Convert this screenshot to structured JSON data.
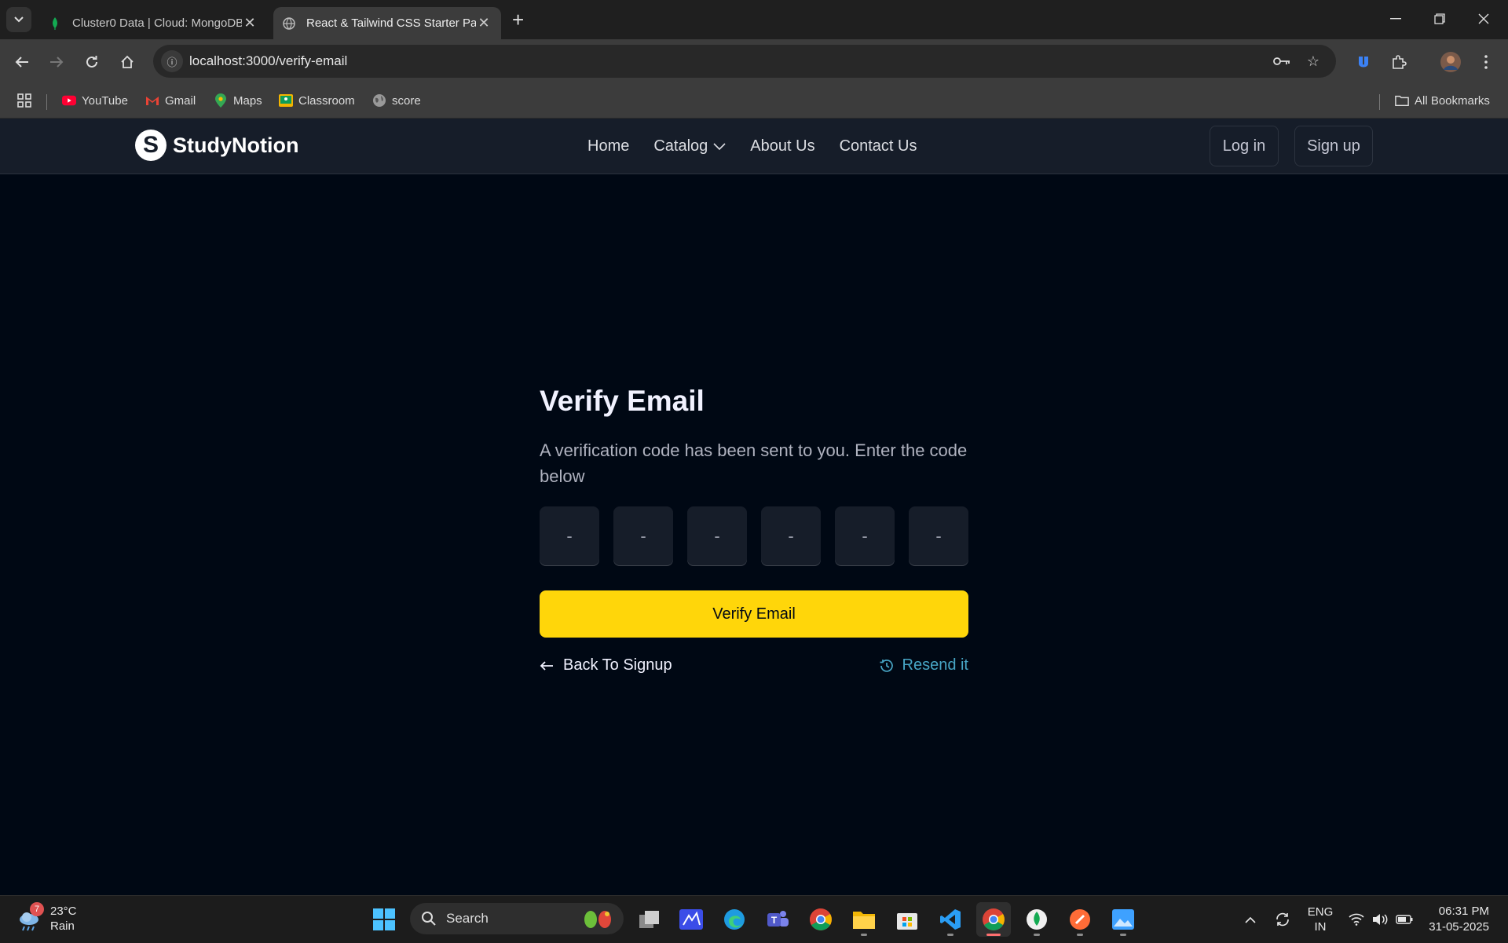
{
  "browser": {
    "tabs": [
      {
        "title": "Cluster0 Data | Cloud: MongoDB Cloud",
        "active": false
      },
      {
        "title": "React & Tailwind CSS Starter Pack",
        "active": true
      }
    ],
    "address": "localhost:3000/verify-email",
    "bookmarks": [
      {
        "label": "YouTube",
        "icon": "youtube-icon"
      },
      {
        "label": "Gmail",
        "icon": "gmail-icon"
      },
      {
        "label": "Maps",
        "icon": "maps-icon"
      },
      {
        "label": "Classroom",
        "icon": "classroom-icon"
      },
      {
        "label": "score",
        "icon": "globe-icon"
      }
    ],
    "all_bookmarks": "All Bookmarks"
  },
  "site": {
    "brand": "StudyNotion",
    "logo_letter": "S",
    "nav": [
      "Home",
      "Catalog",
      "About Us",
      "Contact Us"
    ],
    "login": "Log in",
    "signup": "Sign up"
  },
  "verify": {
    "title": "Verify Email",
    "subtitle": "A verification code has been sent to you. Enter the code below",
    "otp_placeholder": "-",
    "button": "Verify Email",
    "back": "Back To Signup",
    "resend": "Resend it"
  },
  "taskbar": {
    "weather": {
      "temp": "23°C",
      "desc": "Rain",
      "badge": "7"
    },
    "search": "Search",
    "lang": {
      "line1": "ENG",
      "line2": "IN"
    },
    "time": "06:31 PM",
    "date": "31-05-2025"
  },
  "colors": {
    "accent": "#ffd60a",
    "link": "#47a5c5",
    "page_bg": "#000814",
    "nav_bg": "#161d29"
  }
}
